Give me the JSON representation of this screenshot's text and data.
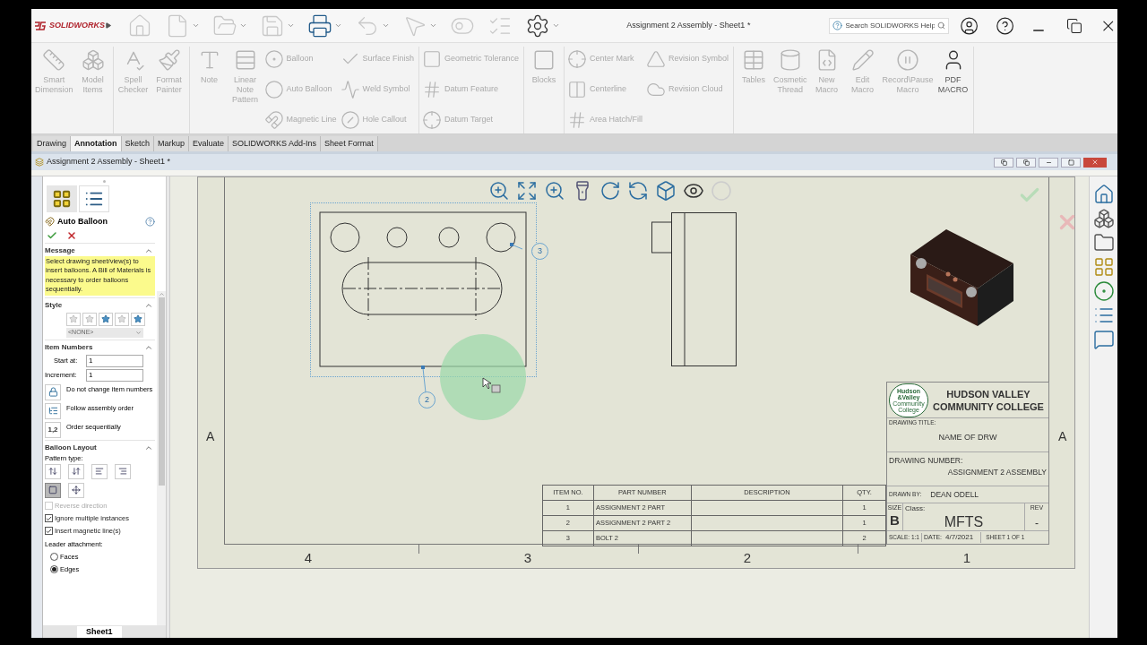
{
  "app": {
    "logo": "SOLIDWORKS",
    "title": "Assignment 2 Assembly - Sheet1 *",
    "search_placeholder": "Search SOLIDWORKS Help"
  },
  "ribbon": [
    {
      "tools": [
        {
          "kind": "large",
          "label": "Smart Dimension",
          "disabled": true
        },
        {
          "kind": "large",
          "label": "Model Items",
          "disabled": true
        }
      ]
    },
    {
      "tools": [
        {
          "kind": "large",
          "label": "Spell Checker",
          "disabled": true
        },
        {
          "kind": "large",
          "label": "Format Painter",
          "disabled": true
        }
      ]
    },
    {
      "tools": [
        {
          "kind": "large",
          "label": "Note",
          "disabled": true
        },
        {
          "kind": "large",
          "label": "Linear Note Pattern",
          "disabled": true
        },
        {
          "kind": "stack",
          "items": [
            {
              "label": "Balloon",
              "disabled": true
            },
            {
              "label": "Auto Balloon",
              "disabled": true
            },
            {
              "label": "Magnetic Line",
              "disabled": true
            }
          ]
        },
        {
          "kind": "stack",
          "items": [
            {
              "label": "Surface Finish",
              "disabled": true
            },
            {
              "label": "Weld Symbol",
              "disabled": true
            },
            {
              "label": "Hole Callout",
              "disabled": true
            }
          ]
        }
      ]
    },
    {
      "tools": [
        {
          "kind": "stack",
          "items": [
            {
              "label": "Geometric Tolerance",
              "disabled": true
            },
            {
              "label": "Datum Feature",
              "disabled": true
            },
            {
              "label": "Datum Target",
              "disabled": true
            }
          ]
        }
      ]
    },
    {
      "tools": [
        {
          "kind": "large",
          "label": "Blocks",
          "disabled": true
        }
      ]
    },
    {
      "tools": [
        {
          "kind": "stack",
          "items": [
            {
              "label": "Center Mark",
              "disabled": true
            },
            {
              "label": "Centerline",
              "disabled": true
            },
            {
              "label": "Area Hatch/Fill",
              "disabled": true
            }
          ]
        },
        {
          "kind": "stack",
          "items": [
            {
              "label": "Revision Symbol",
              "disabled": true
            },
            {
              "label": "Revision Cloud",
              "disabled": true
            }
          ]
        }
      ]
    },
    {
      "tools": [
        {
          "kind": "large",
          "label": "Tables",
          "disabled": true
        },
        {
          "kind": "large",
          "label": "Cosmetic Thread",
          "disabled": true
        },
        {
          "kind": "large",
          "label": "New Macro",
          "disabled": true
        },
        {
          "kind": "large",
          "label": "Edit Macro",
          "disabled": true
        },
        {
          "kind": "large",
          "label": "Record\\Pause Macro",
          "disabled": true
        },
        {
          "kind": "large",
          "label": "PDF MACRO",
          "disabled": false
        }
      ]
    }
  ],
  "tabs": [
    {
      "label": "Drawing",
      "selected": false
    },
    {
      "label": "Annotation",
      "selected": true
    },
    {
      "label": "Sketch",
      "selected": false
    },
    {
      "label": "Markup",
      "selected": false
    },
    {
      "label": "Evaluate",
      "selected": false
    },
    {
      "label": "SOLIDWORKS Add-Ins",
      "selected": false
    },
    {
      "label": "Sheet Format",
      "selected": false
    }
  ],
  "document": {
    "title": "Assignment 2 Assembly - Sheet1 *"
  },
  "panel": {
    "title": "Auto Balloon",
    "message": {
      "heading": "Message",
      "expanded": true,
      "text": "Select drawing sheet/view(s) to insert balloons. A Bill of Materials is necessary to order balloons sequentially."
    },
    "style": {
      "heading": "Style",
      "expanded": true,
      "select": "<NONE>"
    },
    "item_numbers": {
      "heading": "Item Numbers",
      "expanded": true,
      "fields": [
        {
          "label": "Start at:",
          "value": "1"
        },
        {
          "label": "Increment:",
          "value": "1"
        }
      ],
      "options": [
        {
          "label": "Do not change item numbers"
        },
        {
          "label": "Follow assembly order"
        },
        {
          "label": "Order sequentially",
          "icon_text": "1,2"
        }
      ]
    },
    "balloon_layout": {
      "heading": "Balloon Layout",
      "expanded": true,
      "pattern_label": "Pattern type:",
      "patterns": [
        {
          "selected": false
        },
        {
          "selected": false
        },
        {
          "selected": false
        },
        {
          "selected": false
        },
        {
          "selected": true
        },
        {
          "selected": false
        }
      ],
      "checkboxes": [
        {
          "label": "Reverse direction",
          "checked": false,
          "disabled": true
        },
        {
          "label": "Ignore multiple instances",
          "checked": true,
          "disabled": false
        },
        {
          "label": "Insert magnetic line(s)",
          "checked": true,
          "disabled": false
        }
      ],
      "leader_label": "Leader attachment:",
      "radios": [
        {
          "label": "Faces",
          "selected": false
        },
        {
          "label": "Edges",
          "selected": true
        }
      ]
    }
  },
  "sheet_tabs": [
    {
      "label": "Sheet1",
      "selected": true
    }
  ],
  "sheet": {
    "zone_letters": [
      "A",
      "A"
    ],
    "zone_numbers": [
      "4",
      "3",
      "2",
      "1"
    ],
    "balloons": [
      "3",
      "2"
    ],
    "bom": {
      "columns": [
        "ITEM NO.",
        "PART NUMBER",
        "DESCRIPTION",
        "QTY."
      ],
      "rows": [
        {
          "item_no": "1",
          "part_number": "ASSIGNMENT 2 PART",
          "qty": "1"
        },
        {
          "item_no": "2",
          "part_number": "ASSIGNMENT 2 PART 2",
          "qty": "1"
        },
        {
          "item_no": "3",
          "part_number": "BOLT 2",
          "qty": "2"
        }
      ]
    },
    "title_block": {
      "logo_lines": [
        "Hudson",
        "&Valley",
        "Community College"
      ],
      "school_lines": [
        "HUDSON VALLEY",
        "COMMUNITY COLLEGE"
      ],
      "drawing_title_label": "DRAWING TITLE:",
      "drawing_title": "NAME OF DRW",
      "drawing_number_label": "DRAWING NUMBER:",
      "drawing_number": "ASSIGNMENT 2 ASSEMBLY",
      "drawn_by_label": "DRAWN BY:",
      "drawn_by": "DEAN ODELL",
      "size_label": "SIZE",
      "size": "B",
      "class_label": "Class:",
      "class": "MFTS",
      "rev_label": "REV",
      "rev": "-",
      "scale": "SCALE: 1:1",
      "date_label": "DATE:",
      "date": "4/7/2021",
      "sheet": "SHEET 1 OF 1"
    }
  }
}
